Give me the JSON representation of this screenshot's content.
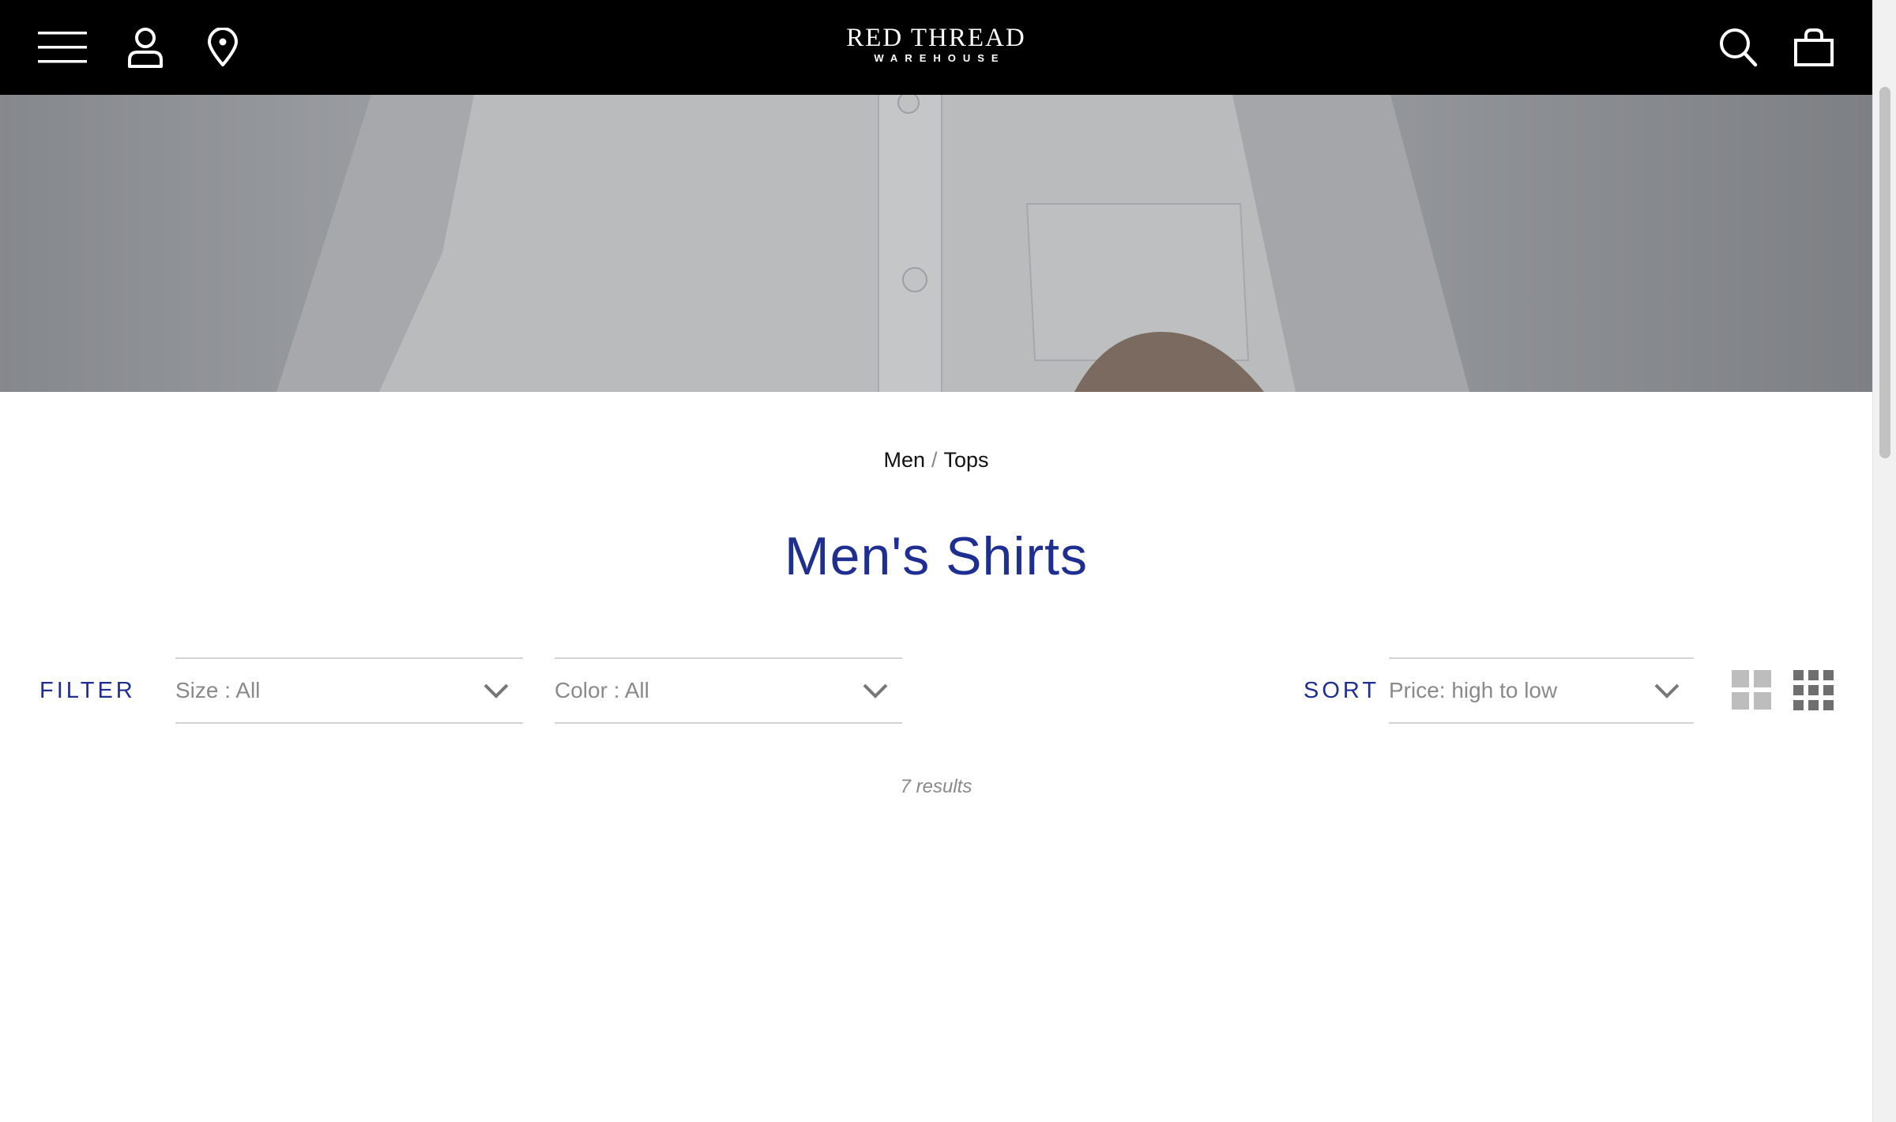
{
  "header": {
    "logo_main": "RED THREAD",
    "logo_sub": "WAREHOUSE",
    "icons": [
      "menu-icon",
      "account-icon",
      "location-icon",
      "search-icon",
      "shopping-bag-icon"
    ],
    "background": "#000000"
  },
  "hero": {
    "image": "man in white button-down shirt, grey overlay"
  },
  "breadcrumb": {
    "items": [
      "Men",
      "Tops"
    ],
    "separator": "/"
  },
  "page_title": "Men's Shirts",
  "filter": {
    "label": "FILTER",
    "size_label": "Size : All",
    "color_label": "Color : All"
  },
  "sort": {
    "label": "SORT",
    "value": "Price: high to low"
  },
  "view_options": [
    "grid-2-icon",
    "grid-3-icon"
  ],
  "results_text": "7 results",
  "colors": {
    "accent": "#1e2f8f",
    "muted": "#8a8a8a"
  }
}
